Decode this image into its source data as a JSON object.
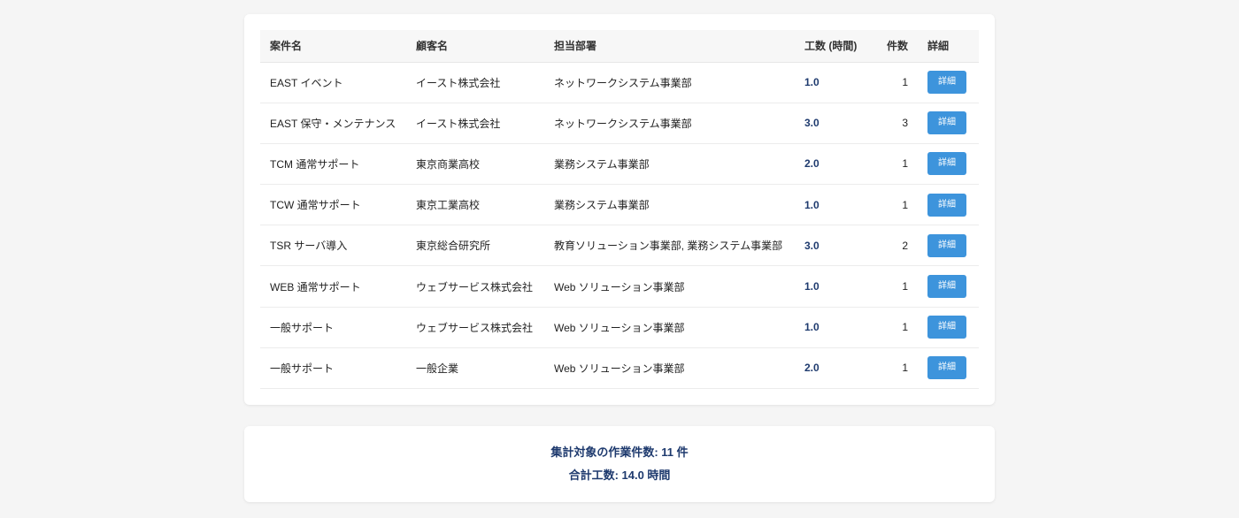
{
  "table": {
    "headers": {
      "project": "案件名",
      "customer": "顧客名",
      "department": "担当部署",
      "hours": "工数 (時間)",
      "count": "件数",
      "detail": "詳細"
    },
    "rows": [
      {
        "project": "EAST イベント",
        "customer": "イースト株式会社",
        "department": "ネットワークシステム事業部",
        "hours": "1.0",
        "count": "1",
        "detail": "詳細"
      },
      {
        "project": "EAST 保守・メンテナンス",
        "customer": "イースト株式会社",
        "department": "ネットワークシステム事業部",
        "hours": "3.0",
        "count": "3",
        "detail": "詳細"
      },
      {
        "project": "TCM 通常サポート",
        "customer": "東京商業高校",
        "department": "業務システム事業部",
        "hours": "2.0",
        "count": "1",
        "detail": "詳細"
      },
      {
        "project": "TCW 通常サポート",
        "customer": "東京工業高校",
        "department": "業務システム事業部",
        "hours": "1.0",
        "count": "1",
        "detail": "詳細"
      },
      {
        "project": "TSR サーバ導入",
        "customer": "東京総合研究所",
        "department": "教育ソリューション事業部, 業務システム事業部",
        "hours": "3.0",
        "count": "2",
        "detail": "詳細"
      },
      {
        "project": "WEB 通常サポート",
        "customer": "ウェブサービス株式会社",
        "department": "Web ソリューション事業部",
        "hours": "1.0",
        "count": "1",
        "detail": "詳細"
      },
      {
        "project": "一般サポート",
        "customer": "ウェブサービス株式会社",
        "department": "Web ソリューション事業部",
        "hours": "1.0",
        "count": "1",
        "detail": "詳細"
      },
      {
        "project": "一般サポート",
        "customer": "一般企業",
        "department": "Web ソリューション事業部",
        "hours": "2.0",
        "count": "1",
        "detail": "詳細"
      }
    ]
  },
  "summary": {
    "task_count": "集計対象の作業件数: 11 件",
    "total_hours": "合計工数: 14.0 時間"
  },
  "colors": {
    "accent": "#3d94dc",
    "emphasis_text": "#1e3a6e",
    "background": "#f5f5f5"
  }
}
